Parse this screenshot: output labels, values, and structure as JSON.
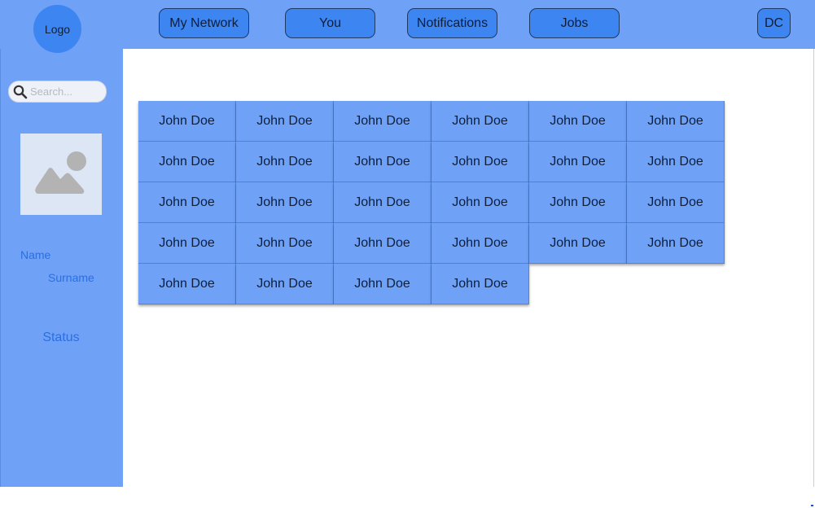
{
  "header": {
    "nav": {
      "my_network": "My Network",
      "you": "You",
      "notifications": "Notifications",
      "jobs": "Jobs",
      "avatar_initials": "DC"
    }
  },
  "sidebar": {
    "logo": "Logo",
    "search": {
      "placeholder": "Search...",
      "value": ""
    },
    "profile": {
      "name": "Name",
      "surname": "Surname",
      "status": "Status"
    }
  },
  "main": {
    "connections": [
      "John Doe",
      "John Doe",
      "John Doe",
      "John Doe",
      "John Doe",
      "John Doe",
      "John Doe",
      "John Doe",
      "John Doe",
      "John Doe",
      "John Doe",
      "John Doe",
      "John Doe",
      "John Doe",
      "John Doe",
      "John Doe",
      "John Doe",
      "John Doe",
      "John Doe",
      "John Doe",
      "John Doe",
      "John Doe",
      "John Doe",
      "John Doe",
      "John Doe",
      "John Doe",
      "John Doe",
      "John Doe"
    ]
  },
  "colors": {
    "panel": "#6fa1f6",
    "button": "#3d85f0",
    "accent_text": "#2b6fe0"
  }
}
